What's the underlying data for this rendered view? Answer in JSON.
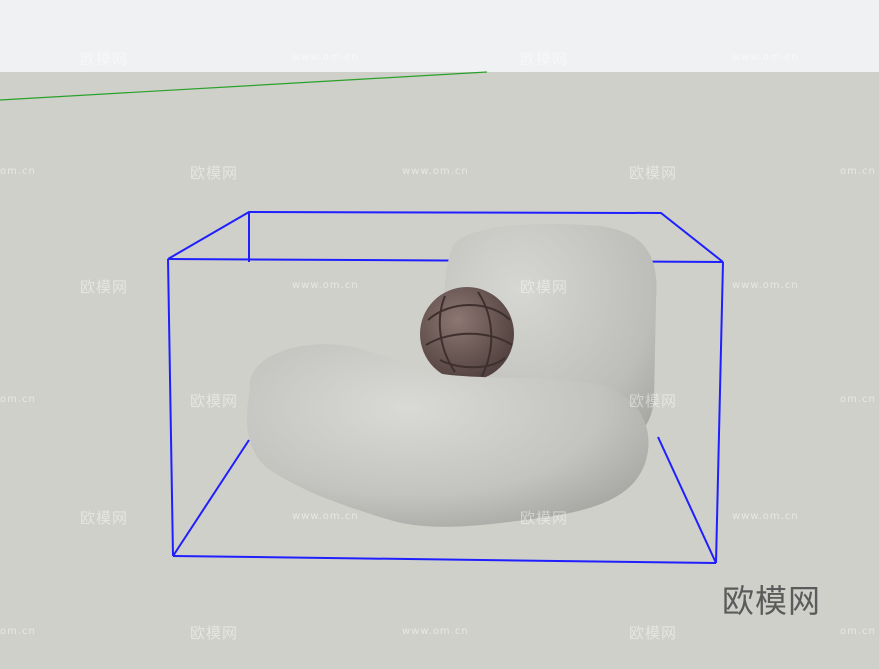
{
  "watermarks": {
    "brand_small": "欧模网",
    "url": "www.om.cn",
    "url_partial": "om.cn"
  },
  "brand_logo": {
    "text": "欧模网"
  },
  "colors": {
    "toolbar_bg": "#f0f1f3",
    "viewport_bg": "#cfd0ca",
    "selection_box": "#1f1fff",
    "axis_green": "#2aa12a",
    "sofa": "#c4c4c0",
    "knot_pillow": "#6e5a55"
  },
  "icons": {
    "selection": "bounding-box-selection",
    "axis": "green-axis-line"
  }
}
